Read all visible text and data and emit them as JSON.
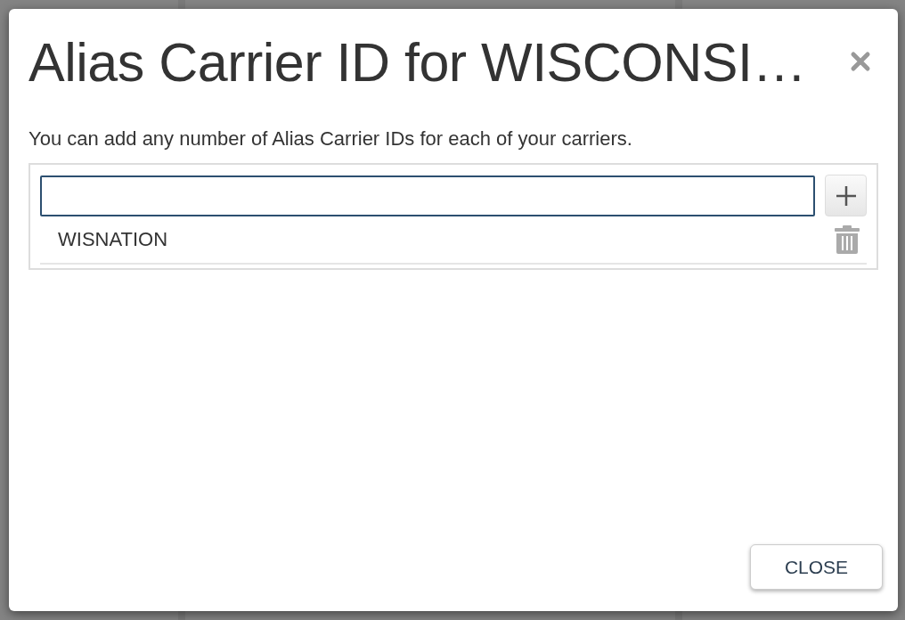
{
  "dialog": {
    "title": "Alias Carrier ID for WISCONSI…",
    "description": "You can add any number of Alias Carrier IDs for each of your carriers.",
    "aliases": [
      {
        "name": "WISNATION"
      }
    ],
    "buttons": [
      {
        "label": "CLOSE"
      }
    ]
  }
}
